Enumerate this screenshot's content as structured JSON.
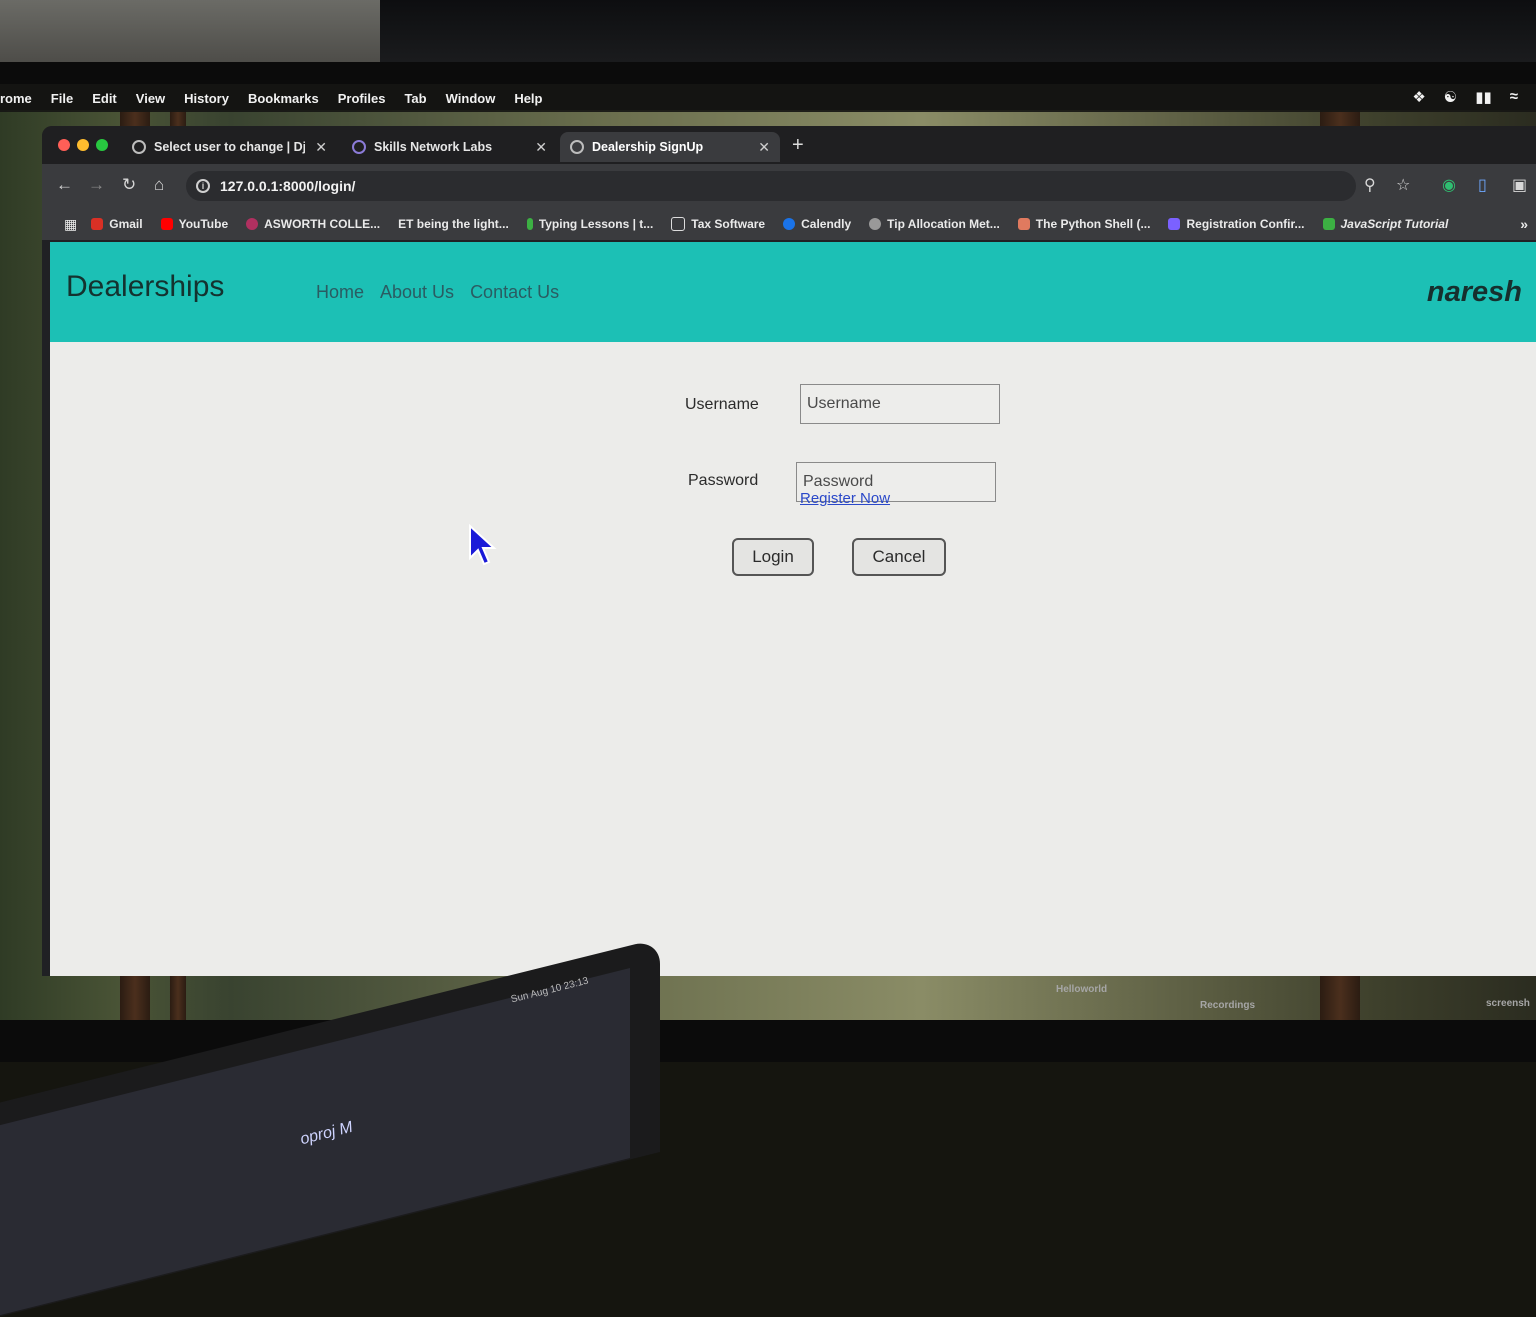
{
  "macos_menu": {
    "app": "rome",
    "items": [
      "File",
      "Edit",
      "View",
      "History",
      "Bookmarks",
      "Profiles",
      "Tab",
      "Window",
      "Help"
    ]
  },
  "browser": {
    "tabs": [
      {
        "label": "Select user to change | Djang",
        "active": false
      },
      {
        "label": "Skills Network Labs",
        "active": false
      },
      {
        "label": "Dealership SignUp",
        "active": true
      }
    ],
    "url": "127.0.0.1:8000/login/",
    "bookmarks": [
      {
        "label": "Gmail",
        "color": "#d93025"
      },
      {
        "label": "YouTube",
        "color": "#ff0000"
      },
      {
        "label": "ASWORTH COLLE...",
        "color": "#b03060"
      },
      {
        "label": "ET being the light...",
        "color": "#555555"
      },
      {
        "label": "Typing Lessons | t...",
        "color": "#3cb043"
      },
      {
        "label": "Tax Software",
        "color": "#bbbbbb"
      },
      {
        "label": "Calendly",
        "color": "#1a73e8"
      },
      {
        "label": "Tip Allocation Met...",
        "color": "#999999"
      },
      {
        "label": "The Python Shell (...",
        "color": "#e07a5f"
      },
      {
        "label": "Registration Confir...",
        "color": "#7b61ff"
      },
      {
        "label": "JavaScript Tutorial",
        "color": "#3cb043"
      }
    ]
  },
  "page": {
    "brand": "Dealerships",
    "nav": {
      "home": "Home",
      "about": "About Us",
      "contact": "Contact Us"
    },
    "user": "naresh",
    "login": {
      "username_label": "Username",
      "username_placeholder": "Username",
      "password_label": "Password",
      "password_placeholder": "Password",
      "login_button": "Login",
      "cancel_button": "Cancel",
      "register_link": "Register Now"
    },
    "theme": {
      "navbar": "#1cc0b5",
      "link": "#2a48c9"
    }
  },
  "desktop": {
    "labels": [
      "Helloworld",
      "Recordings",
      "screensh"
    ]
  },
  "laptop": {
    "clock": "Sun Aug 10  23:13",
    "editor_text": "oproj M"
  }
}
